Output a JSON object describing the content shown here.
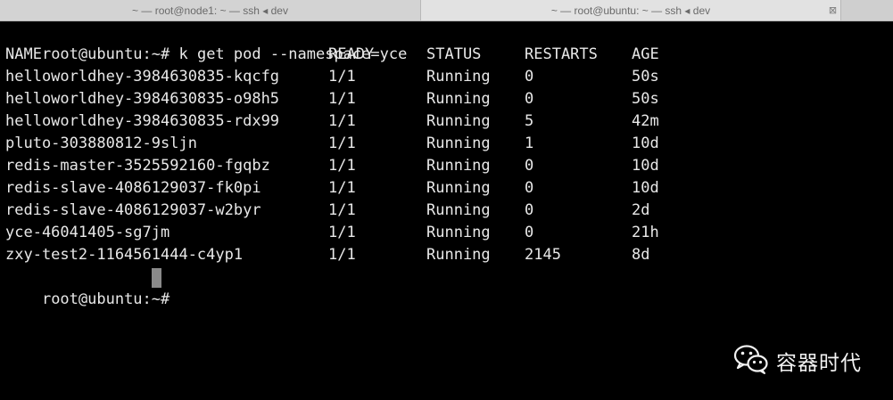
{
  "tabs": [
    {
      "label": "~ — root@node1: ~ — ssh ◂ dev"
    },
    {
      "label": "~ — root@ubuntu: ~ — ssh ◂ dev"
    }
  ],
  "tab_close_glyph": "⊠",
  "prompt": "root@ubuntu:~# ",
  "command": "k get pod --namespace=yce",
  "table": {
    "headers": [
      "NAME",
      "READY",
      "STATUS",
      "RESTARTS",
      "AGE"
    ],
    "rows": [
      [
        "helloworldhey-3984630835-kqcfg",
        "1/1",
        "Running",
        "0",
        "50s"
      ],
      [
        "helloworldhey-3984630835-o98h5",
        "1/1",
        "Running",
        "0",
        "50s"
      ],
      [
        "helloworldhey-3984630835-rdx99",
        "1/1",
        "Running",
        "5",
        "42m"
      ],
      [
        "pluto-303880812-9sljn",
        "1/1",
        "Running",
        "1",
        "10d"
      ],
      [
        "redis-master-3525592160-fgqbz",
        "1/1",
        "Running",
        "0",
        "10d"
      ],
      [
        "redis-slave-4086129037-fk0pi",
        "1/1",
        "Running",
        "0",
        "10d"
      ],
      [
        "redis-slave-4086129037-w2byr",
        "1/1",
        "Running",
        "0",
        "2d"
      ],
      [
        "yce-46041405-sg7jm",
        "1/1",
        "Running",
        "0",
        "21h"
      ],
      [
        "zxy-test2-1164561444-c4yp1",
        "1/1",
        "Running",
        "2145",
        "8d"
      ]
    ]
  },
  "final_prompt": "root@ubuntu:~# ",
  "watermark": {
    "text": "容器时代",
    "icon": "wechat-icon"
  }
}
